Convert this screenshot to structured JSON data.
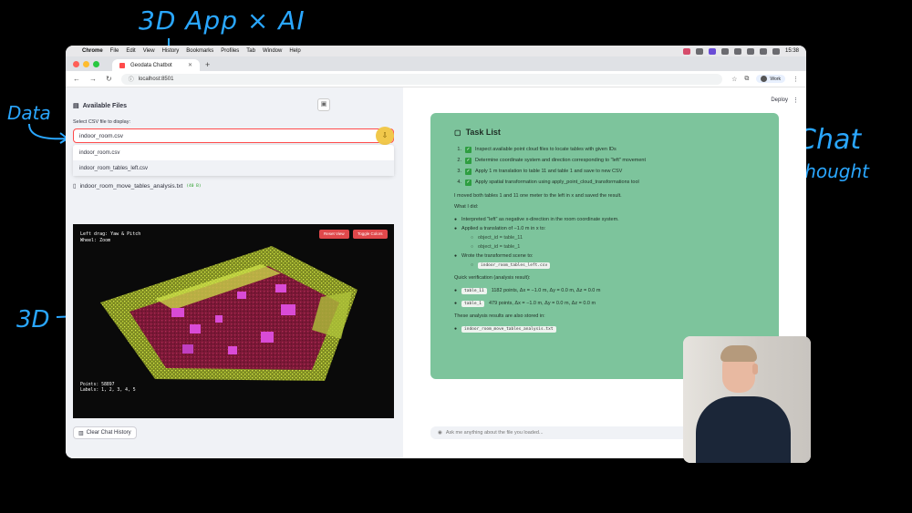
{
  "annotations": {
    "title": "3D App × AI",
    "data": "Data",
    "three_d": "3D",
    "chat": "Chat",
    "thought": "Thought"
  },
  "menubar": {
    "app": "Chrome",
    "items": [
      "File",
      "Edit",
      "View",
      "History",
      "Bookmarks",
      "Profiles",
      "Tab",
      "Window",
      "Help"
    ],
    "clock": "15:38"
  },
  "browser": {
    "tab_title": "Geodata Chatbot",
    "new_tab": "+",
    "url": "localhost:8501",
    "profile": "Work"
  },
  "sidebar": {
    "title": "Available Files",
    "select_label": "Select CSV file to display:",
    "select_value": "indoor_room.csv",
    "options": [
      "indoor_room.csv",
      "indoor_room_tables_left.csv"
    ],
    "analysis_file": "indoor_room_move_tables_analysis.txt",
    "analysis_size": "(40 B)",
    "clear_button": "Clear Chat History"
  },
  "viewer": {
    "hint_line1": "Left drag: Yaw & Pitch",
    "hint_line2": "Wheel: Zoom",
    "reset_view": "Reset View",
    "toggle_colors": "Toggle Colors",
    "points": "Points: 58897",
    "labels": "Labels: 1, 2, 3, 4, 5"
  },
  "header": {
    "deploy": "Deploy"
  },
  "chat": {
    "task_title": "Task List",
    "tasks": [
      "Inspect available point cloud files to locate tables with given IDs",
      "Determine coordinate system and direction corresponding to \"left\" movement",
      "Apply 1 m translation to table 11 and table 1 and save to new CSV",
      "Apply spatial transformation using apply_point_cloud_transformations tool"
    ],
    "summary": "I moved both tables 1 and 11 one meter to the left in x and saved the result.",
    "what_i_did": "What I did:",
    "did_1": "Interpreted \"left\" as negative x-direction in the room coordinate system.",
    "did_2": "Applied a translation of −1.0 m in x to:",
    "sub_1": "object_id = table_11",
    "sub_2": "object_id = table_1",
    "did_3": "Wrote the transformed scene to:",
    "out_file": "indoor_room_tables_left.csv",
    "quick_verif": "Quick verification (analysis result):",
    "v1_code": "table_11",
    "v1_text": "1182 points, Δx = −1.0 m, Δy = 0.0 m, Δz = 0.0 m",
    "v2_code": "table_1",
    "v2_text": "479 points, Δx = −1.0 m, Δy = 0.0 m, Δz = 0.0 m",
    "stored": "These analysis results are also stored in:",
    "stored_file": "indoor_room_move_tables_analysis.txt",
    "input_placeholder": "Ask me anything about the file you loaded..."
  },
  "colors": {
    "accent": "#ff4b4b",
    "chat_bg": "#7dc49c",
    "annotation": "#2aa7ff",
    "floor": "#8a1f3c",
    "walls": "#c8d43a",
    "tables": "#d94bd6"
  }
}
